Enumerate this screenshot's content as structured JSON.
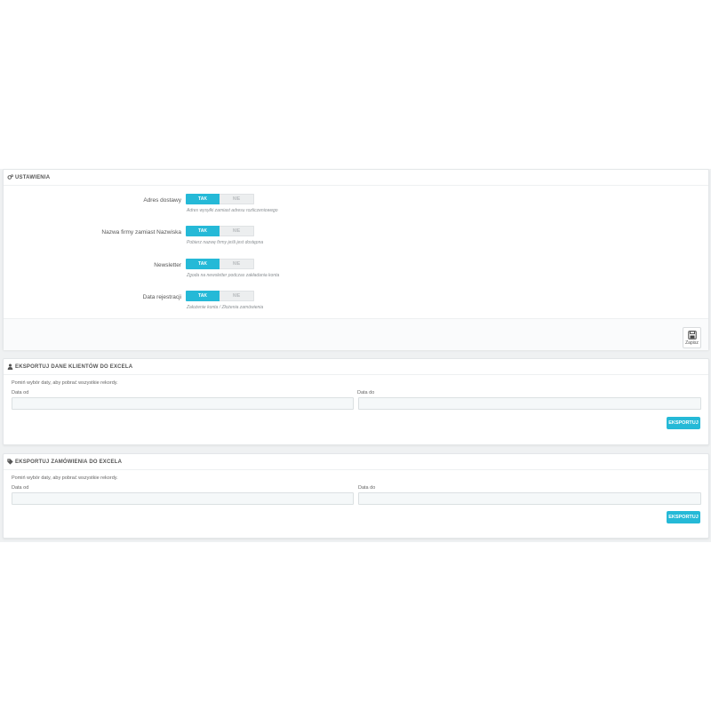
{
  "settings": {
    "title": "USTAWIENIA",
    "options": [
      {
        "label": "Adres dostawy",
        "on": "TAK",
        "off": "NIE",
        "help": "Adres wysyłki zamiast adresu rozliczeniowego"
      },
      {
        "label": "Nazwa firmy zamiast Nazwiska",
        "on": "TAK",
        "off": "NIE",
        "help": "Pobierz nazwę firmy jeśli jest dostępna"
      },
      {
        "label": "Newsletter",
        "on": "TAK",
        "off": "NIE",
        "help": "Zgoda na newsletter podczas zakładania konta"
      },
      {
        "label": "Data rejestracji",
        "on": "TAK",
        "off": "NIE",
        "help": "Założenie konta / Złożenia zamówienia"
      }
    ],
    "save_label": "Zapisz"
  },
  "export_customers": {
    "title": "EKSPORTUJ DANE KLIENTÓW DO EXCELA",
    "intro": "Pomiń wybór daty, aby pobrać wszystkie rekordy.",
    "date_from_label": "Data od",
    "date_to_label": "Data do",
    "date_from_value": "",
    "date_to_value": "",
    "button": "EKSPORTUJ"
  },
  "export_orders": {
    "title": "EKSPORTUJ ZAMÓWIENIA DO EXCELA",
    "intro": "Pomiń wybór daty, aby pobrać wszystkie rekordy.",
    "date_from_label": "Data od",
    "date_to_label": "Data do",
    "date_from_value": "",
    "date_to_value": "",
    "button": "EKSPORTUJ"
  },
  "icons": {
    "settings": "cogs-icon",
    "customers": "user-icon",
    "orders": "tags-icon",
    "save": "floppy-disk-icon"
  },
  "colors": {
    "accent": "#25b9d7",
    "panel_bg": "#ffffff",
    "page_bg": "#eff1f2"
  }
}
